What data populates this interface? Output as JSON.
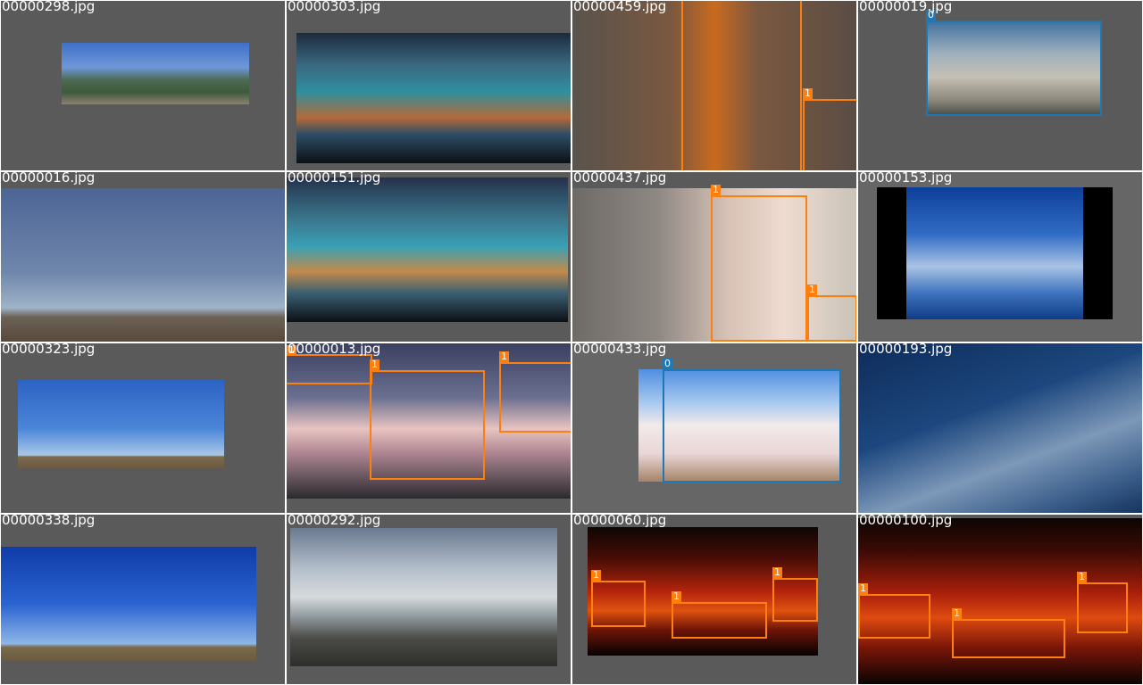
{
  "tiles": [
    {
      "filename": "00000298.jpg",
      "labels": []
    },
    {
      "filename": "00000303.jpg",
      "labels": []
    },
    {
      "filename": "00000459.jpg",
      "labels": [
        "1"
      ]
    },
    {
      "filename": "00000019.jpg",
      "labels": [
        "0"
      ]
    },
    {
      "filename": "00000016.jpg",
      "labels": []
    },
    {
      "filename": "00000151.jpg",
      "labels": []
    },
    {
      "filename": "00000437.jpg",
      "labels": [
        "1",
        "1"
      ]
    },
    {
      "filename": "00000153.jpg",
      "labels": []
    },
    {
      "filename": "00000323.jpg",
      "labels": []
    },
    {
      "filename": "00000013.jpg",
      "labels": [
        "1",
        "1",
        "1"
      ]
    },
    {
      "filename": "00000433.jpg",
      "labels": [
        "0"
      ]
    },
    {
      "filename": "00000193.jpg",
      "labels": []
    },
    {
      "filename": "00000338.jpg",
      "labels": []
    },
    {
      "filename": "00000292.jpg",
      "labels": []
    },
    {
      "filename": "00000060.jpg",
      "labels": [
        "1",
        "1",
        "1"
      ]
    },
    {
      "filename": "00000100.jpg",
      "labels": [
        "1",
        "1",
        "1"
      ]
    }
  ],
  "class_colors": {
    "0": "#1f77b4",
    "1": "#ff7f0e"
  }
}
